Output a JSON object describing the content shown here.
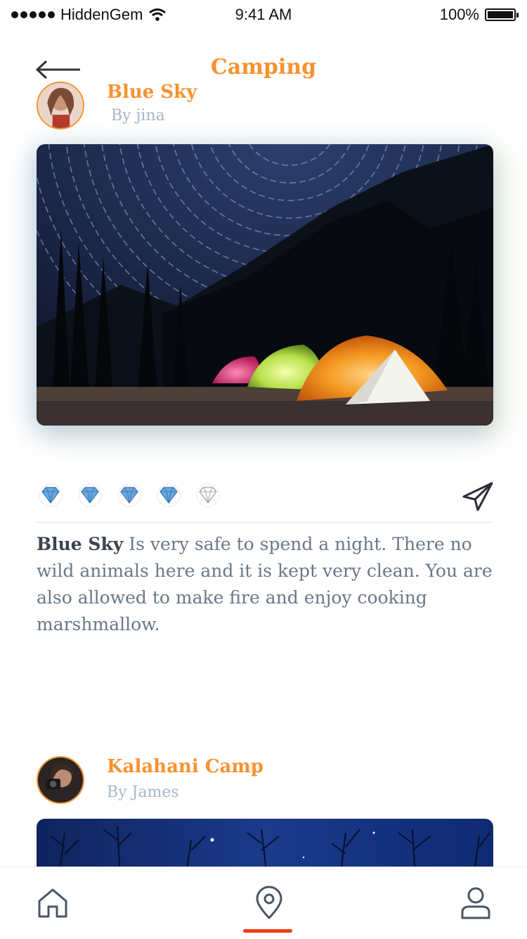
{
  "status_bar": {
    "carrier": "HiddenGem",
    "time": "9:41 AM",
    "battery": "100%"
  },
  "header": {
    "title": "Camping",
    "back_icon": "back-arrow-icon"
  },
  "posts": [
    {
      "name": "Blue Sky",
      "author": "By jina",
      "rating": {
        "value": 4,
        "max": 5,
        "icon": "diamond-icon"
      },
      "description_bold": "Blue Sky",
      "description_text": " Is very safe to spend a night. There no wild animals here and it is kept very clean. You are also allowed to make fire and enjoy cooking marshmallow."
    },
    {
      "name": "Kalahani Camp",
      "author": "By James"
    }
  ],
  "nav": {
    "items": [
      "home-icon",
      "location-pin-icon",
      "profile-icon"
    ],
    "active": "location-pin-icon"
  },
  "colors": {
    "accent": "#f7922f",
    "active_indicator": "#f33c1a",
    "muted_text": "#a9b6c7"
  }
}
